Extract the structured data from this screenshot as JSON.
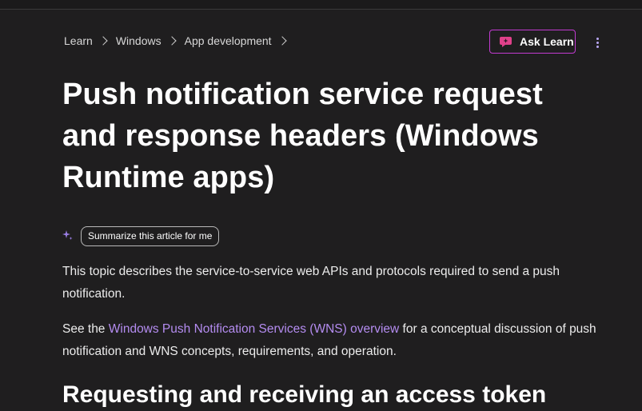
{
  "breadcrumb": {
    "items": [
      "Learn",
      "Windows",
      "App development"
    ]
  },
  "header": {
    "ask_learn_label": "Ask Learn"
  },
  "article": {
    "title": "Push notification service request and response headers (Windows Runtime apps)",
    "summarize_label": "Summarize this article for me",
    "intro": "This topic describes the service-to-service web APIs and protocols required to send a push notification.",
    "see_prefix": "See the ",
    "see_link": "Windows Push Notification Services (WNS) overview",
    "see_suffix": " for a conceptual discussion of push notification and WNS concepts, requirements, and operation.",
    "next_heading": "Requesting and receiving an access token"
  },
  "colors": {
    "background": "#1f1e1f",
    "link": "#b48cf0",
    "ask_border": "#c23bd1",
    "ask_icon": "#e0418a"
  },
  "icons": [
    "chevron-right-icon",
    "ask-learn-icon",
    "more-vertical-icon",
    "sparkle-icon"
  ]
}
